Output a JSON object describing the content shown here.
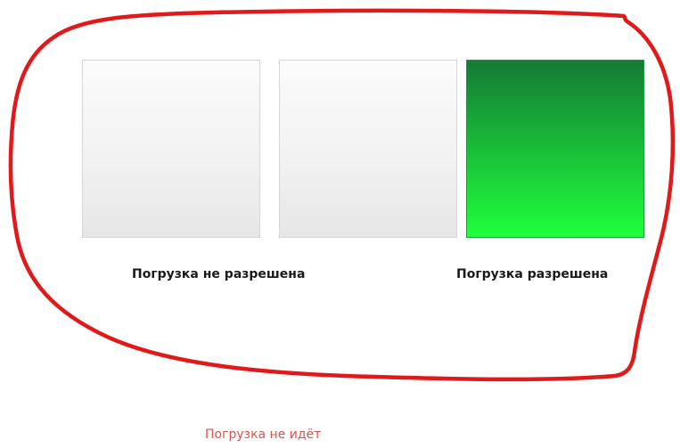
{
  "tiles": [
    {
      "name": "tile-1",
      "state": "gray"
    },
    {
      "name": "tile-2",
      "state": "gray"
    },
    {
      "name": "tile-3",
      "state": "green"
    }
  ],
  "labels": {
    "not_allowed": "Погрузка не разрешена",
    "allowed": "Погрузка разрешена"
  },
  "status_text": "Погрузка не идёт",
  "colors": {
    "annotation_red": "#e01a1a",
    "status_red": "#d9534f",
    "green_top": "#157a36",
    "green_bottom": "#1fff3c"
  }
}
